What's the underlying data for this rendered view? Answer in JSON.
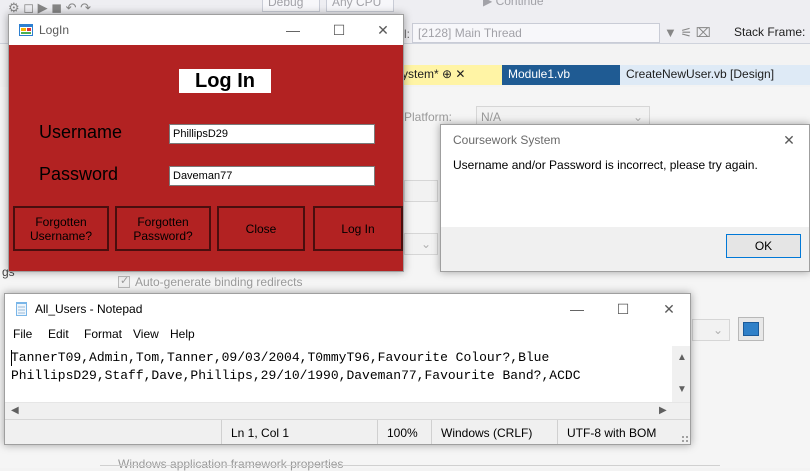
{
  "vs": {
    "debug_label": "Debug",
    "cpu_label": "Any CPU",
    "continue_label": "▶ Continue",
    "process_label": "[2128] Main Thread",
    "stack_frame_label": "Stack Frame:",
    "tabs": [
      {
        "label": "ystem*  ⊕  ✕"
      },
      {
        "label": "Module1.vb"
      },
      {
        "label": "CreateNewUser.vb [Design]"
      }
    ],
    "platform_label": "Platform:",
    "platform_value": "N/A",
    "auto_generate_label": "Auto-generate binding redirects",
    "fieldset_label": "Windows application framework properties",
    "gs_fragment": "gs"
  },
  "login": {
    "title": "LogIn",
    "heading": "Log In",
    "username_label": "Username",
    "username_value": "PhillipsD29",
    "password_label": "Password",
    "password_value": "Daveman77",
    "buttons": {
      "forgot_user": "Forgotten Username?",
      "forgot_pass": "Forgotten Password?",
      "close": "Close",
      "login": "Log In"
    },
    "accent_color": "#B22222"
  },
  "msgbox": {
    "title": "Coursework System",
    "message": "Username and/or Password is incorrect, please try again.",
    "ok_label": "OK"
  },
  "notepad": {
    "title": "All_Users - Notepad",
    "menu": [
      "File",
      "Edit",
      "Format",
      "View",
      "Help"
    ],
    "lines": [
      "TannerT09,Admin,Tom,Tanner,09/03/2004,T0mmyT96,Favourite Colour?,Blue",
      "PhillipsD29,Staff,Dave,Phillips,29/10/1990,Daveman77,Favourite Band?,ACDC"
    ],
    "status": {
      "position": "Ln 1, Col 1",
      "zoom": "100%",
      "line_ending": "Windows (CRLF)",
      "encoding": "UTF-8 with BOM"
    }
  }
}
